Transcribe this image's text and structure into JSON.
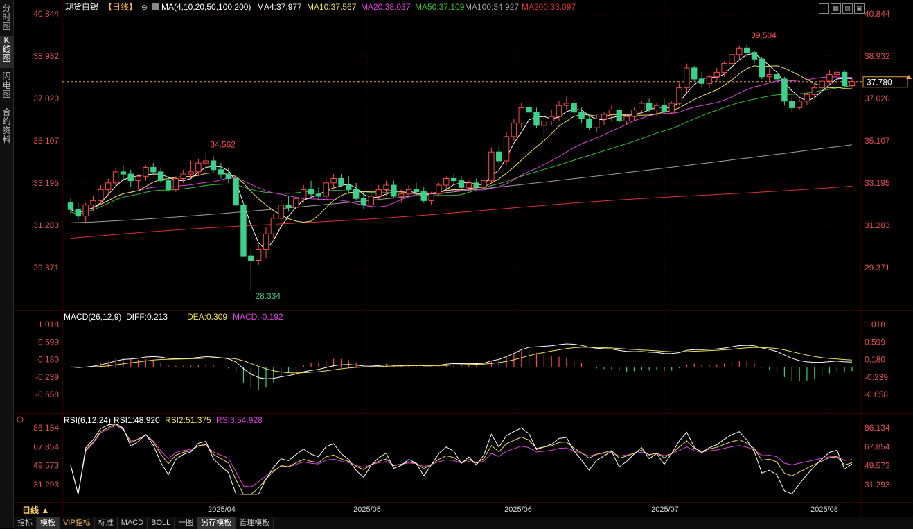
{
  "left_tabs": [
    {
      "label": "分时图",
      "active": false
    },
    {
      "label": "K线图",
      "active": true
    },
    {
      "label": "闪电图",
      "active": false
    },
    {
      "label": "合约资料",
      "active": false
    }
  ],
  "header": {
    "instrument": "现货白银",
    "period": "【日线】",
    "ma_title": "MA(4,10,20,50,100,200)",
    "ma_values": [
      {
        "text": "MA4:37.977",
        "color": "#ffffff"
      },
      {
        "text": "MA10:37.567",
        "color": "#f0e050"
      },
      {
        "text": "MA20:38.037",
        "color": "#e040e0"
      },
      {
        "text": "MA50:37.109",
        "color": "#30c030"
      },
      {
        "text": "MA100:34.927",
        "color": "#a0a0a0"
      },
      {
        "text": "MA200:33.097",
        "color": "#e03030"
      }
    ]
  },
  "price_axis": {
    "labels": [
      "40.844",
      "38.932",
      "37.020",
      "35.107",
      "33.195",
      "31.283",
      "29.371"
    ],
    "current": "37.780"
  },
  "annotations": {
    "high": "39.504",
    "mid_high": "34.562",
    "low": "28.334"
  },
  "macd": {
    "title": "MACD(26,12,9)",
    "diff": "DIFF:0.213",
    "dea": "DEA:0.309",
    "macd": "MACD:-0.192",
    "labels": [
      "1.018",
      "0.599",
      "0.180",
      "-0.239",
      "-0.658"
    ]
  },
  "rsi": {
    "title": "RSI(6,12,24)",
    "rsi1": "RSI1:48.920",
    "rsi2": "RSI2:51.375",
    "rsi3": "RSI3:54.928",
    "labels": [
      "86.134",
      "67.854",
      "49.573",
      "31.293"
    ]
  },
  "x_axis": [
    "2025/04",
    "2025/05",
    "2025/06",
    "2025/07",
    "2025/08"
  ],
  "period_tag": "日线",
  "bottom_buttons": [
    "指标",
    "模板",
    "VIP指标",
    "标准",
    "MACD",
    "BOLL",
    "一图",
    "另存模板",
    "管理模板"
  ],
  "colors": {
    "up": "#ff4a4a",
    "down": "#3cd08a",
    "ma4": "#ffffff",
    "ma10": "#f0e050",
    "ma20": "#e040e0",
    "ma50": "#30c030",
    "ma100": "#a0a0a0",
    "ma200": "#e03030",
    "grid": "#3a0000"
  },
  "chart_data": {
    "type": "candlestick",
    "candles": [
      [
        32.3,
        32.5,
        31.8,
        32.0
      ],
      [
        32.0,
        32.3,
        31.5,
        31.7
      ],
      [
        31.7,
        32.3,
        31.4,
        32.2
      ],
      [
        32.2,
        32.6,
        31.9,
        32.4
      ],
      [
        32.4,
        33.1,
        32.2,
        32.9
      ],
      [
        32.9,
        33.4,
        32.6,
        33.2
      ],
      [
        33.2,
        33.9,
        33.0,
        33.7
      ],
      [
        33.7,
        34.0,
        33.3,
        33.6
      ],
      [
        33.6,
        33.8,
        33.0,
        33.3
      ],
      [
        33.3,
        33.6,
        32.9,
        33.5
      ],
      [
        33.5,
        34.0,
        33.3,
        33.9
      ],
      [
        33.9,
        34.1,
        33.6,
        33.7
      ],
      [
        33.7,
        33.9,
        33.2,
        33.3
      ],
      [
        33.3,
        33.5,
        32.8,
        32.9
      ],
      [
        32.9,
        33.5,
        32.8,
        33.4
      ],
      [
        33.4,
        33.8,
        33.2,
        33.6
      ],
      [
        33.6,
        34.2,
        33.4,
        33.7
      ],
      [
        33.7,
        34.3,
        33.5,
        34.1
      ],
      [
        34.1,
        34.56,
        33.8,
        34.2
      ],
      [
        34.2,
        34.4,
        33.7,
        33.8
      ],
      [
        33.8,
        34.1,
        33.4,
        33.6
      ],
      [
        33.6,
        33.9,
        33.2,
        33.4
      ],
      [
        33.4,
        33.6,
        32.1,
        32.2
      ],
      [
        32.2,
        32.3,
        29.9,
        29.9
      ],
      [
        29.9,
        30.3,
        28.33,
        29.7
      ],
      [
        29.7,
        30.5,
        29.5,
        30.2
      ],
      [
        30.2,
        31.2,
        29.8,
        30.9
      ],
      [
        30.9,
        31.8,
        30.7,
        31.6
      ],
      [
        31.6,
        32.4,
        31.3,
        32.2
      ],
      [
        32.2,
        32.6,
        31.9,
        32.1
      ],
      [
        32.1,
        32.7,
        31.9,
        32.5
      ],
      [
        32.5,
        33.1,
        32.3,
        32.9
      ],
      [
        32.9,
        33.3,
        32.5,
        32.7
      ],
      [
        32.7,
        33.0,
        32.4,
        32.6
      ],
      [
        32.6,
        33.5,
        32.4,
        33.2
      ],
      [
        33.2,
        33.6,
        32.9,
        33.4
      ],
      [
        33.4,
        33.6,
        33.0,
        33.1
      ],
      [
        33.1,
        33.5,
        32.7,
        32.9
      ],
      [
        32.9,
        33.2,
        32.4,
        32.5
      ],
      [
        32.5,
        32.8,
        32.0,
        32.2
      ],
      [
        32.2,
        32.7,
        32.0,
        32.6
      ],
      [
        32.6,
        33.1,
        32.4,
        32.9
      ],
      [
        32.9,
        33.3,
        32.6,
        33.1
      ],
      [
        33.1,
        33.3,
        32.5,
        32.6
      ],
      [
        32.6,
        32.9,
        32.3,
        32.7
      ],
      [
        32.7,
        33.1,
        32.5,
        32.9
      ],
      [
        32.9,
        33.2,
        32.6,
        32.8
      ],
      [
        32.8,
        33.0,
        32.3,
        32.4
      ],
      [
        32.4,
        32.8,
        32.2,
        32.7
      ],
      [
        32.7,
        33.2,
        32.6,
        33.1
      ],
      [
        33.1,
        33.5,
        32.9,
        33.4
      ],
      [
        33.4,
        33.6,
        33.1,
        33.3
      ],
      [
        33.3,
        33.5,
        32.9,
        33.0
      ],
      [
        33.0,
        33.3,
        32.9,
        33.2
      ],
      [
        33.2,
        33.4,
        32.9,
        33.0
      ],
      [
        33.0,
        33.5,
        32.9,
        33.3
      ],
      [
        33.3,
        34.8,
        33.2,
        34.6
      ],
      [
        34.6,
        34.9,
        34.0,
        34.2
      ],
      [
        34.2,
        35.5,
        34.0,
        35.3
      ],
      [
        35.3,
        36.1,
        35.1,
        35.9
      ],
      [
        35.9,
        36.8,
        35.7,
        36.6
      ],
      [
        36.6,
        36.9,
        36.3,
        36.4
      ],
      [
        36.4,
        36.6,
        35.7,
        35.8
      ],
      [
        35.8,
        36.2,
        35.4,
        36.0
      ],
      [
        36.0,
        36.5,
        35.8,
        36.2
      ],
      [
        36.2,
        36.9,
        36.0,
        36.7
      ],
      [
        36.7,
        37.1,
        36.5,
        36.8
      ],
      [
        36.8,
        37.0,
        36.3,
        36.4
      ],
      [
        36.4,
        36.6,
        35.9,
        36.1
      ],
      [
        36.1,
        36.3,
        35.6,
        35.7
      ],
      [
        35.7,
        36.3,
        35.5,
        36.1
      ],
      [
        36.1,
        36.4,
        35.8,
        36.3
      ],
      [
        36.3,
        36.7,
        36.0,
        36.5
      ],
      [
        36.5,
        36.6,
        35.9,
        36.0
      ],
      [
        36.0,
        36.3,
        35.8,
        36.2
      ],
      [
        36.2,
        36.6,
        36.0,
        36.5
      ],
      [
        36.5,
        36.9,
        36.3,
        36.8
      ],
      [
        36.8,
        37.0,
        36.4,
        36.5
      ],
      [
        36.5,
        36.8,
        36.2,
        36.7
      ],
      [
        36.7,
        37.0,
        36.3,
        36.4
      ],
      [
        36.4,
        36.9,
        36.3,
        36.8
      ],
      [
        36.8,
        37.7,
        36.7,
        37.5
      ],
      [
        37.5,
        38.6,
        37.3,
        38.4
      ],
      [
        38.4,
        38.5,
        37.8,
        37.9
      ],
      [
        37.9,
        38.2,
        37.5,
        37.7
      ],
      [
        37.7,
        38.1,
        37.5,
        38.0
      ],
      [
        38.0,
        38.4,
        37.8,
        38.2
      ],
      [
        38.2,
        38.7,
        38.0,
        38.6
      ],
      [
        38.6,
        39.2,
        38.4,
        39.0
      ],
      [
        39.0,
        39.4,
        38.8,
        39.3
      ],
      [
        39.3,
        39.5,
        38.9,
        39.1
      ],
      [
        39.1,
        39.2,
        38.6,
        38.8
      ],
      [
        38.8,
        38.9,
        37.9,
        38.0
      ],
      [
        38.0,
        38.4,
        37.8,
        38.1
      ],
      [
        38.1,
        38.3,
        37.7,
        37.9
      ],
      [
        37.9,
        38.0,
        36.7,
        36.9
      ],
      [
        36.9,
        37.1,
        36.4,
        36.6
      ],
      [
        36.6,
        37.0,
        36.5,
        36.9
      ],
      [
        36.9,
        37.3,
        36.7,
        37.2
      ],
      [
        37.2,
        37.7,
        37.0,
        37.5
      ],
      [
        37.5,
        38.0,
        37.3,
        37.8
      ],
      [
        37.8,
        38.3,
        37.6,
        38.1
      ],
      [
        38.1,
        38.4,
        37.8,
        38.2
      ],
      [
        38.2,
        38.3,
        37.5,
        37.6
      ],
      [
        37.6,
        37.9,
        37.5,
        37.78
      ]
    ]
  }
}
